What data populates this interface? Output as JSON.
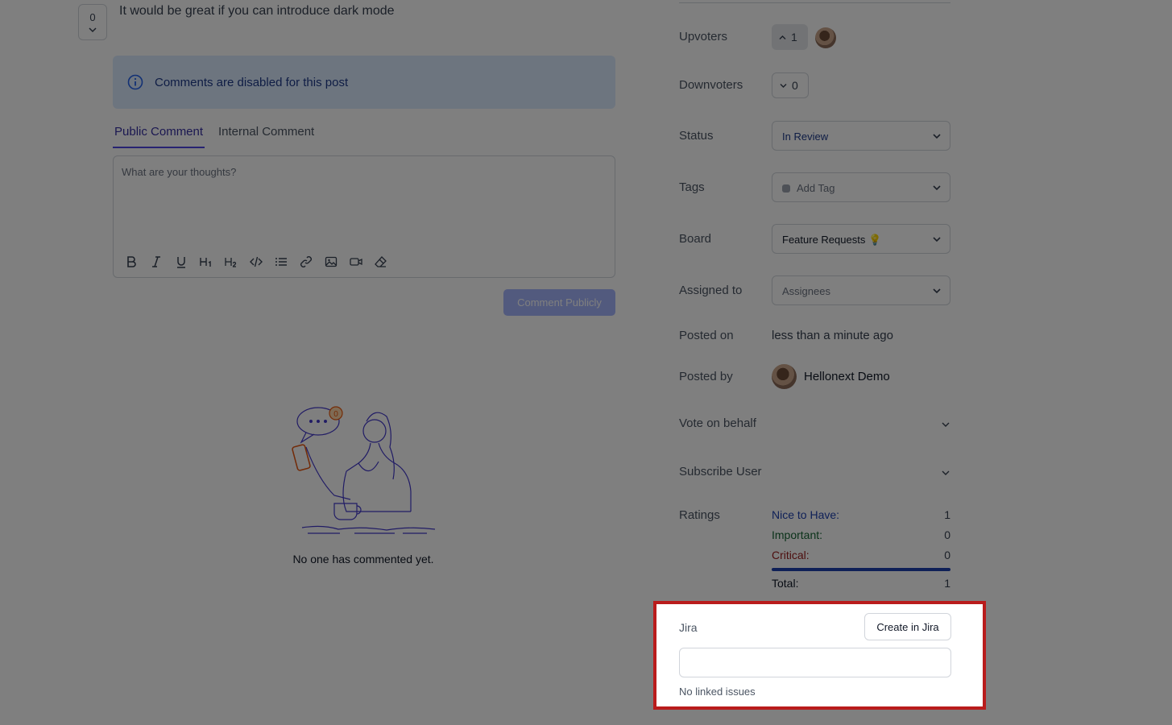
{
  "post": {
    "vote_count": "0",
    "description": "It would be great if you can introduce dark mode"
  },
  "banner": {
    "message": "Comments are disabled for this post"
  },
  "tabs": [
    {
      "label": "Public Comment"
    },
    {
      "label": "Internal Comment"
    }
  ],
  "editor": {
    "placeholder": "What are your thoughts?",
    "tools": [
      "bold-icon",
      "italic-icon",
      "underline-icon",
      "heading-1-icon",
      "heading-2-icon",
      "code-icon",
      "list-icon",
      "link-icon",
      "image-icon",
      "video-icon",
      "eraser-icon"
    ]
  },
  "comment_button": "Comment Publicly",
  "empty_state": {
    "text": "No one has commented yet.",
    "bubble_count": "0"
  },
  "sidebar": {
    "upvoters_label": "Upvoters",
    "upvote_count": "1",
    "downvoters_label": "Downvoters",
    "downvote_count": "0",
    "status_label": "Status",
    "status_value": "In Review",
    "tags_label": "Tags",
    "tags_placeholder": "Add Tag",
    "board_label": "Board",
    "board_value": "Feature Requests 💡",
    "assigned_label": "Assigned to",
    "assigned_placeholder": "Assignees",
    "posted_on_label": "Posted on",
    "posted_on_value": "less than a minute ago",
    "posted_by_label": "Posted by",
    "posted_by_value": "Hellonext Demo",
    "vote_on_behalf_label": "Vote on behalf",
    "subscribe_user_label": "Subscribe User",
    "ratings_label": "Ratings",
    "ratings": [
      {
        "label": "Nice to Have:",
        "value": "1",
        "color": "#1e40af"
      },
      {
        "label": "Important:",
        "value": "0",
        "color": "#166534"
      },
      {
        "label": "Critical:",
        "value": "0",
        "color": "#991b1b"
      }
    ],
    "total_label": "Total:",
    "total_value": "1"
  },
  "jira": {
    "label": "Jira",
    "button": "Create in Jira",
    "empty": "No linked issues"
  },
  "colors": {
    "accent": "#4f46e5",
    "highlight": "#b91c1c"
  }
}
